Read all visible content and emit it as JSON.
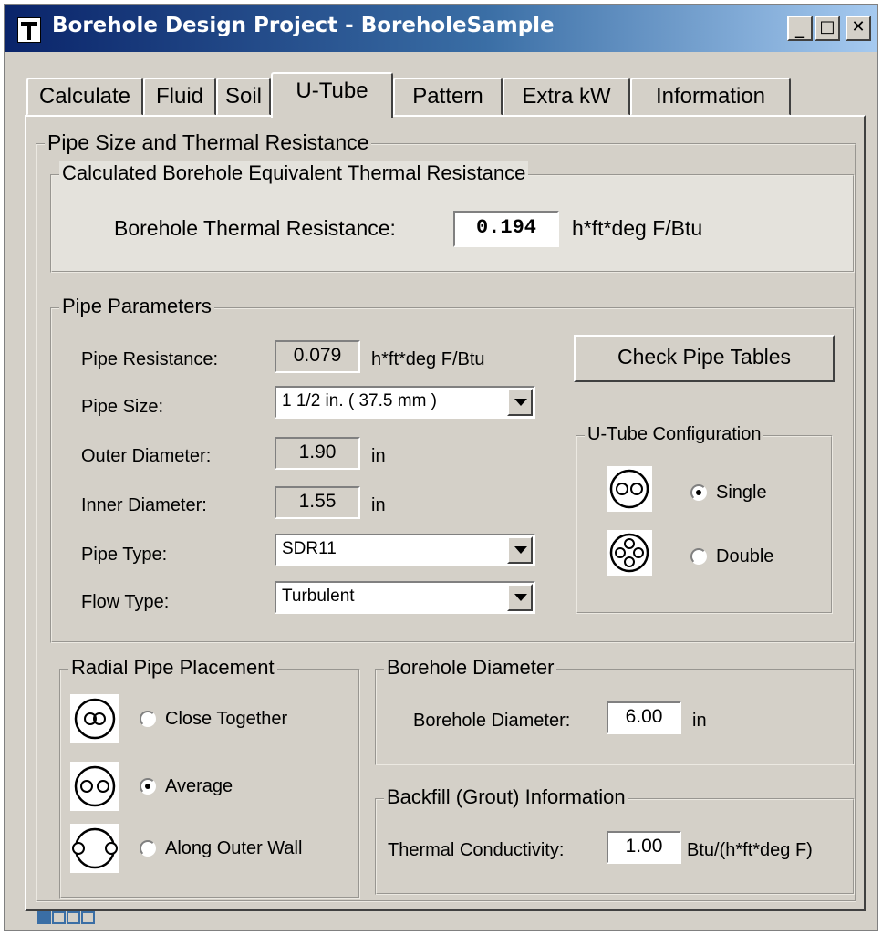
{
  "window": {
    "title": "Borehole Design Project - BoreholeSample",
    "minimize_glyph": "_",
    "maximize_glyph": "□",
    "close_glyph": "✕"
  },
  "tabs": [
    "Calculate",
    "Fluid",
    "Soil",
    "U-Tube",
    "Pattern",
    "Extra kW",
    "Information"
  ],
  "active_tab": "U-Tube",
  "pipe_size_group": {
    "legend": "Pipe Size and Thermal Resistance"
  },
  "calculated": {
    "legend": "Calculated Borehole Equivalent Thermal Resistance",
    "label": "Borehole Thermal Resistance:",
    "value": "0.194",
    "unit": "h*ft*deg F/Btu"
  },
  "pipe_params": {
    "legend": "Pipe Parameters",
    "pipe_resistance_label": "Pipe Resistance:",
    "pipe_resistance_value": "0.079",
    "pipe_resistance_unit": "h*ft*deg F/Btu",
    "pipe_size_label": "Pipe Size:",
    "pipe_size_value": "1 1/2 in. ( 37.5 mm )",
    "outer_diameter_label": "Outer Diameter:",
    "outer_diameter_value": "1.90",
    "outer_diameter_unit": "in",
    "inner_diameter_label": "Inner Diameter:",
    "inner_diameter_value": "1.55",
    "inner_diameter_unit": "in",
    "pipe_type_label": "Pipe Type:",
    "pipe_type_value": "SDR11",
    "flow_type_label": "Flow Type:",
    "flow_type_value": "Turbulent",
    "check_button": "Check Pipe Tables"
  },
  "utube_config": {
    "legend": "U-Tube Configuration",
    "options": [
      "Single",
      "Double"
    ],
    "selected": "Single"
  },
  "radial": {
    "legend": "Radial Pipe Placement",
    "options": [
      "Close Together",
      "Average",
      "Along Outer Wall"
    ],
    "selected": "Average"
  },
  "borehole_diameter": {
    "legend": "Borehole Diameter",
    "label": "Borehole Diameter:",
    "value": "6.00",
    "unit": "in"
  },
  "backfill": {
    "legend": "Backfill (Grout) Information",
    "label": "Thermal Conductivity:",
    "value": "1.00",
    "unit": "Btu/(h*ft*deg F)"
  },
  "colors": {
    "titlebar_start": "#0a246a",
    "titlebar_end": "#a6caf0",
    "face": "#d4d0c8"
  }
}
